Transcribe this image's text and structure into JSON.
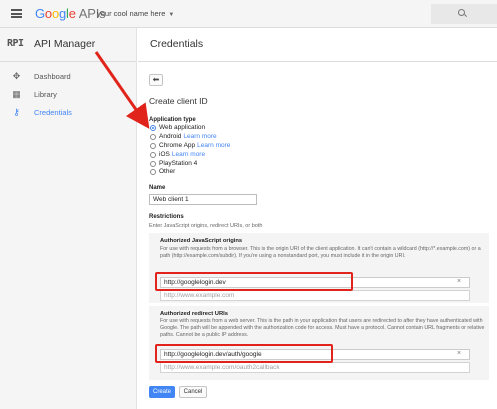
{
  "header": {
    "logo": {
      "letters": [
        "G",
        "o",
        "o",
        "g",
        "l",
        "e"
      ],
      "suffix": "APIs"
    },
    "project_name": "your cool name here",
    "caret": "▼"
  },
  "sidebar": {
    "badge": "RPI",
    "title": "API Manager",
    "items": [
      {
        "label": "Dashboard",
        "icon": "dashboard-icon",
        "glyph": "✥",
        "active": false
      },
      {
        "label": "Library",
        "icon": "library-icon",
        "glyph": "▦",
        "active": false
      },
      {
        "label": "Credentials",
        "icon": "key-icon",
        "glyph": "⚷",
        "active": true
      }
    ]
  },
  "main": {
    "title": "Credentials",
    "back_glyph": "⬅",
    "create_title": "Create client ID",
    "app_type": {
      "label": "Application type",
      "options": [
        {
          "label": "Web application",
          "learn_more": "",
          "selected": true
        },
        {
          "label": "Android",
          "learn_more": "Learn more",
          "selected": false
        },
        {
          "label": "Chrome App",
          "learn_more": "Learn more",
          "selected": false
        },
        {
          "label": "iOS",
          "learn_more": "Learn more",
          "selected": false
        },
        {
          "label": "PlayStation 4",
          "learn_more": "",
          "selected": false
        },
        {
          "label": "Other",
          "learn_more": "",
          "selected": false
        }
      ]
    },
    "name": {
      "label": "Name",
      "value": "Web client 1"
    },
    "restrictions": {
      "label": "Restrictions",
      "hint": "Enter JavaScript origins, redirect URIs, or both",
      "origins": {
        "title": "Authorized JavaScript origins",
        "desc": "For use with requests from a browser. This is the origin URI of the client application. It can't contain a wildcard (http://*.example.com) or a path (http://example.com/subdir). If you're using a nonstandard port, you must include it in the origin URI.",
        "value": "http://googlelogin.dev",
        "placeholder": "http://www.example.com"
      },
      "redirects": {
        "title": "Authorized redirect URIs",
        "desc": "For use with requests from a web server. This is the path in your application that users are redirected to after they have authenticated with Google. The path will be appended with the authorization code for access. Must have a protocol. Cannot contain URL fragments or relative paths. Cannot be a public IP address.",
        "value": "http://googlelogin.dev/auth/google",
        "placeholder": "http://www.example.com/oauth2callback"
      }
    },
    "remove_glyph": "×",
    "buttons": {
      "create": "Create",
      "cancel": "Cancel"
    }
  },
  "annotation_color": "#e0241b",
  "accent_color": "#4285f4"
}
